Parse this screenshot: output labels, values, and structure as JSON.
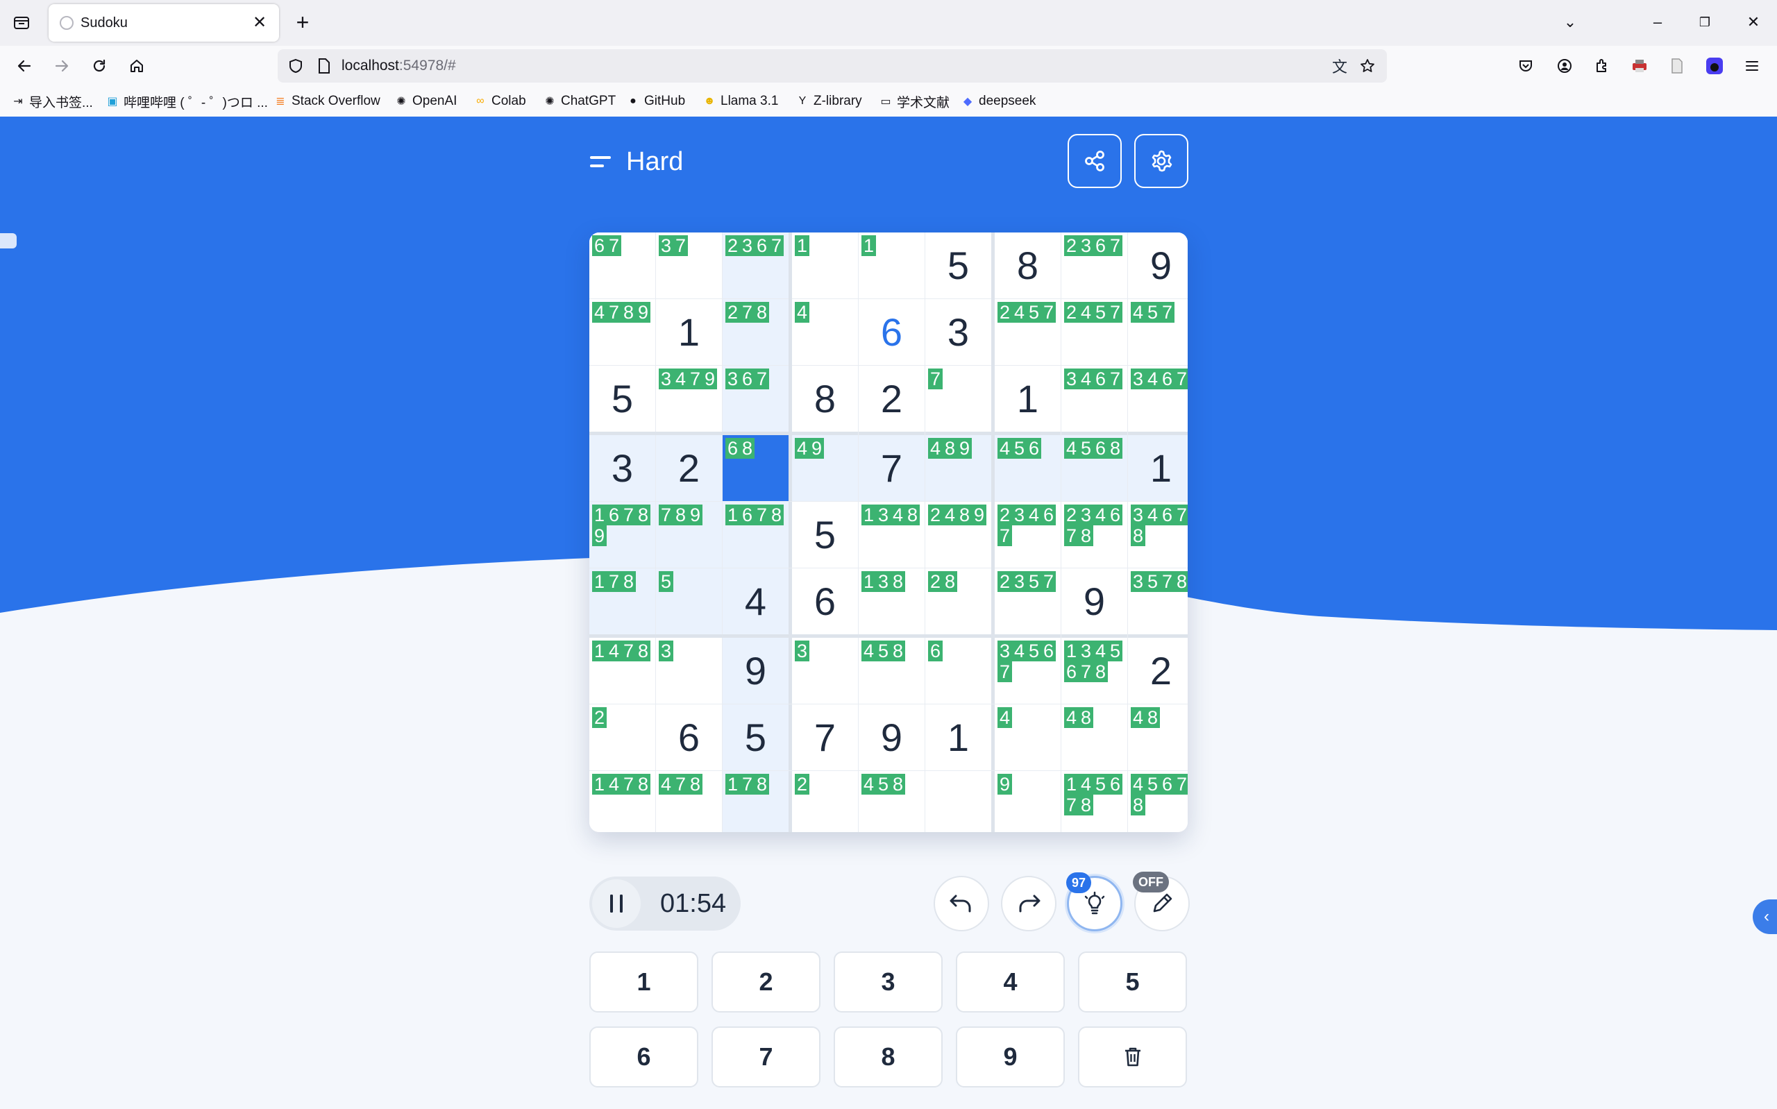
{
  "browser": {
    "tab_title": "Sudoku",
    "url_host": "localhost",
    "url_rest": ":54978/#",
    "bookmarks": [
      "导入书签...",
      "哔哩哔哩 ( ゜- ゜)つロ ...",
      "Stack Overflow",
      "OpenAI",
      "Colab",
      "ChatGPT",
      "GitHub",
      "Llama 3.1",
      "Z-library",
      "学术文献",
      "deepseek"
    ]
  },
  "colors": {
    "primary": "#2a73ea",
    "note_bg": "#3cb371",
    "page_bg": "#f4f7fc"
  },
  "header": {
    "difficulty": "Hard"
  },
  "board": {
    "selected": [
      3,
      2
    ],
    "rows": [
      [
        {
          "n": [
            6,
            7
          ]
        },
        {
          "n": [
            3,
            7
          ]
        },
        {
          "n": [
            2,
            3,
            6,
            7
          ]
        },
        {
          "n": [
            1
          ]
        },
        {
          "n": [
            1
          ]
        },
        {
          "v": "5"
        },
        {
          "v": "8"
        },
        {
          "n": [
            2,
            3,
            6,
            7
          ]
        },
        {
          "v": "9"
        }
      ],
      [
        {
          "n": [
            4,
            7,
            8,
            9
          ]
        },
        {
          "v": "1"
        },
        {
          "n": [
            2,
            7,
            8
          ]
        },
        {
          "n": [
            4
          ]
        },
        {
          "v": "6",
          "u": true
        },
        {
          "v": "3"
        },
        {
          "n": [
            2,
            4,
            5,
            7
          ]
        },
        {
          "n": [
            2,
            4,
            5,
            7
          ]
        },
        {
          "n": [
            4,
            5,
            7
          ]
        }
      ],
      [
        {
          "v": "5"
        },
        {
          "n": [
            3,
            4,
            7,
            9
          ]
        },
        {
          "n": [
            3,
            6,
            7
          ]
        },
        {
          "v": "8"
        },
        {
          "v": "2"
        },
        {
          "n": [
            7
          ]
        },
        {
          "v": "1"
        },
        {
          "n": [
            3,
            4,
            6,
            7
          ]
        },
        {
          "n": [
            3,
            4,
            6,
            7
          ]
        }
      ],
      [
        {
          "v": "3"
        },
        {
          "v": "2"
        },
        {
          "n": [
            6,
            8
          ]
        },
        {
          "n": [
            4,
            9
          ]
        },
        {
          "v": "7"
        },
        {
          "n": [
            4,
            8,
            9
          ]
        },
        {
          "n": [
            4,
            5,
            6
          ]
        },
        {
          "n": [
            4,
            5,
            6,
            8
          ]
        },
        {
          "v": "1"
        }
      ],
      [
        {
          "n": [
            1,
            6,
            7,
            8,
            9
          ]
        },
        {
          "n": [
            7,
            8,
            9
          ]
        },
        {
          "n": [
            1,
            6,
            7,
            8
          ]
        },
        {
          "v": "5"
        },
        {
          "n": [
            1,
            3,
            4,
            8
          ]
        },
        {
          "n": [
            2,
            4,
            8,
            9
          ]
        },
        {
          "n": [
            2,
            3,
            4,
            6,
            7
          ]
        },
        {
          "n": [
            2,
            3,
            4,
            6,
            7,
            8
          ]
        },
        {
          "n": [
            3,
            4,
            6,
            7,
            8
          ]
        }
      ],
      [
        {
          "n": [
            1,
            7,
            8
          ]
        },
        {
          "n": [
            5
          ]
        },
        {
          "v": "4"
        },
        {
          "v": "6"
        },
        {
          "n": [
            1,
            3,
            8
          ]
        },
        {
          "n": [
            2,
            8
          ]
        },
        {
          "n": [
            2,
            3,
            5,
            7
          ]
        },
        {
          "v": "9"
        },
        {
          "n": [
            3,
            5,
            7,
            8
          ]
        }
      ],
      [
        {
          "n": [
            1,
            4,
            7,
            8
          ]
        },
        {
          "n": [
            3
          ]
        },
        {
          "v": "9"
        },
        {
          "n": [
            3
          ]
        },
        {
          "n": [
            4,
            5,
            8
          ]
        },
        {
          "n": [
            6
          ]
        },
        {
          "n": [
            3,
            4,
            5,
            6,
            7
          ]
        },
        {
          "n": [
            1,
            3,
            4,
            5,
            6,
            7,
            8
          ]
        },
        {
          "v": "2"
        }
      ],
      [
        {
          "n": [
            2
          ]
        },
        {
          "v": "6"
        },
        {
          "v": "5"
        },
        {
          "v": "7"
        },
        {
          "v": "9"
        },
        {
          "v": "1"
        },
        {
          "n": [
            4
          ]
        },
        {
          "n": [
            4,
            8
          ]
        },
        {
          "n": [
            4,
            8
          ]
        }
      ],
      [
        {
          "n": [
            1,
            4,
            7,
            8
          ]
        },
        {
          "n": [
            4,
            7,
            8
          ]
        },
        {
          "n": [
            1,
            7,
            8
          ]
        },
        {
          "n": [
            2
          ]
        },
        {
          "n": [
            4,
            5,
            8
          ]
        },
        {},
        {
          "n": [
            9
          ]
        },
        {
          "n": [
            1,
            4,
            5,
            6,
            7,
            8
          ]
        },
        {
          "n": [
            4,
            5,
            6,
            7,
            8
          ]
        }
      ]
    ]
  },
  "controls": {
    "timer": "01:54",
    "hints_remaining": "97",
    "pencil_state": "OFF",
    "keypad": [
      "1",
      "2",
      "3",
      "4",
      "5",
      "6",
      "7",
      "8",
      "9"
    ]
  }
}
